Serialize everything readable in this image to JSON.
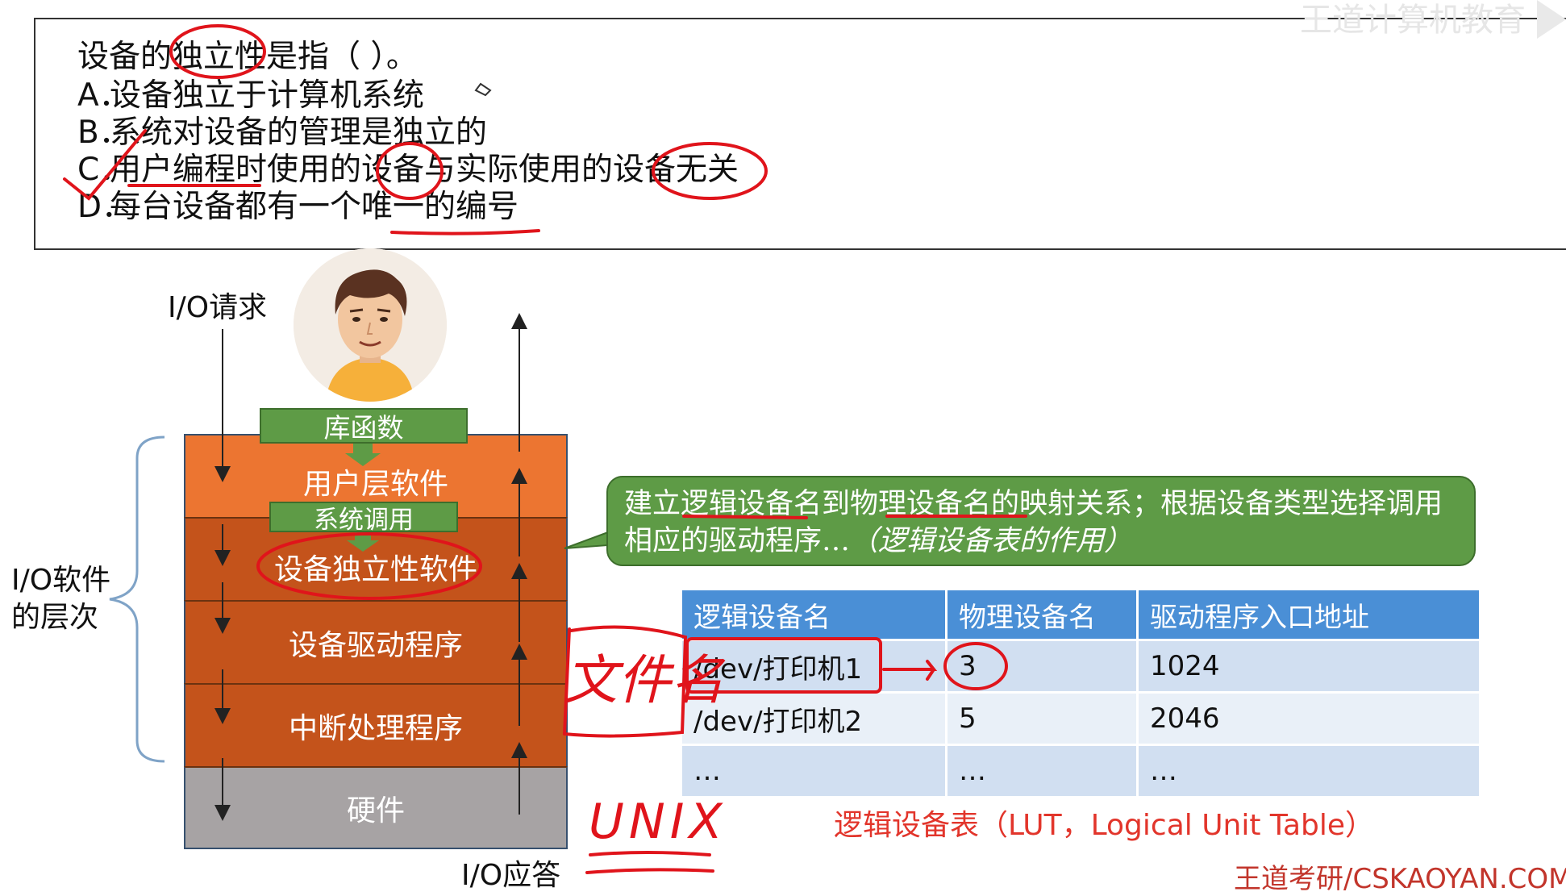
{
  "question": {
    "stem": "设备的独立性是指（ ）。",
    "options": [
      {
        "letter": "A．",
        "text": "设备独立于计算机系统"
      },
      {
        "letter": "B．",
        "text": "系统对设备的管理是独立的"
      },
      {
        "letter": "C．",
        "text": "用户编程时使用的设备与实际使用的设备无关"
      },
      {
        "letter": "D．",
        "text": "每台设备都有一个唯一的编号"
      }
    ]
  },
  "watermark": "王道计算机教育",
  "diagram": {
    "io_request": "I/O请求",
    "io_response": "I/O应答",
    "software_levels": [
      "I/O软件",
      "的层次"
    ],
    "lib_functions": "库函数",
    "system_call": "系统调用",
    "layers": {
      "user": "用户层软件",
      "independent": "设备独立性软件",
      "driver": "设备驱动程序",
      "interrupt": "中断处理程序",
      "hardware": "硬件"
    }
  },
  "callout": {
    "text": "建立逻辑设备名到物理设备名的映射关系；根据设备类型选择调用相应的驱动程序…",
    "italic": "（逻辑设备表的作用）"
  },
  "lut": {
    "headers": [
      "逻辑设备名",
      "物理设备名",
      "驱动程序入口地址"
    ],
    "rows": [
      [
        "/dev/打印机1",
        "3",
        "1024"
      ],
      [
        "/dev/打印机2",
        "5",
        "2046"
      ],
      [
        "…",
        "…",
        "…"
      ]
    ],
    "caption": "逻辑设备表（LUT，Logical Unit Table）"
  },
  "annotations": {
    "filename": "文件名",
    "unix": "UNIX"
  },
  "footer": "王道考研/CSKAOYAN.COM",
  "colors": {
    "orange": "#ec7531",
    "dark_orange": "#c4531b",
    "green": "#5e9b46",
    "blue_header": "#4a8fd6",
    "ink_red": "#e0141b"
  }
}
